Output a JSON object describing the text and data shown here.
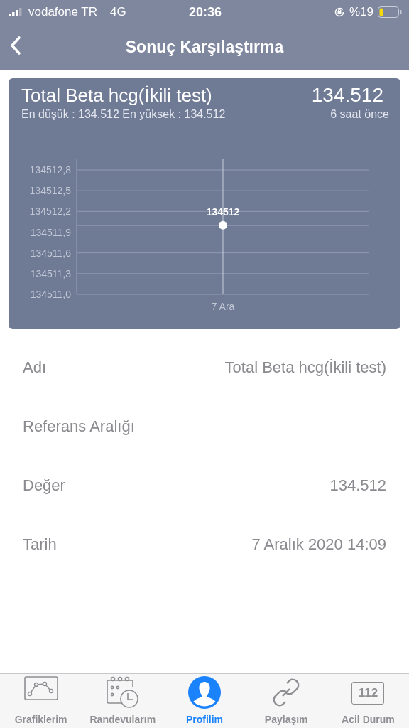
{
  "status_bar": {
    "carrier": "vodafone TR",
    "network": "4G",
    "time": "20:36",
    "battery": "%19"
  },
  "nav": {
    "title": "Sonuç Karşılaştırma"
  },
  "card": {
    "title": "Total Beta hcg(İkili test)",
    "value": "134.512",
    "range": "En düşük : 134.512 En yüksek : 134.512",
    "ago": "6 saat önce",
    "chart_data": {
      "type": "scatter",
      "categories": [
        "7 Ara"
      ],
      "series": [
        {
          "color": "#ffffff",
          "values": [
            134512
          ]
        }
      ],
      "grid": true,
      "ref_lines": [
        {
          "axis": "x",
          "value": "7 Ara"
        },
        {
          "axis": "y",
          "value": 134512
        }
      ],
      "ylim": [
        134511.0,
        134512.8
      ],
      "yticks": [
        {
          "value": 134511.0,
          "label": "134511,0"
        },
        {
          "value": 134511.3,
          "label": "134511,3"
        },
        {
          "value": 134511.6,
          "label": "134511,6"
        },
        {
          "value": 134511.9,
          "label": "134511,9"
        },
        {
          "value": 134512.2,
          "label": "134512,2"
        },
        {
          "value": 134512.5,
          "label": "134512,5"
        },
        {
          "value": 134512.8,
          "label": "134512,8"
        }
      ],
      "data_labels": true,
      "value_labels": [
        "134512"
      ]
    }
  },
  "details": [
    {
      "label": "Adı",
      "value": "Total Beta hcg(İkili test)"
    },
    {
      "label": "Referans Aralığı"
    },
    {
      "label": "Değer",
      "value": "134.512"
    },
    {
      "label": "Tarih",
      "value": "7 Aralık 2020 14:09"
    }
  ],
  "tabs": [
    {
      "kind": "chart",
      "label": "Grafiklerim",
      "selected": false
    },
    {
      "kind": "calendar",
      "label": "Randevularım",
      "selected": false
    },
    {
      "kind": "profile",
      "label": "Profilim",
      "selected": true
    },
    {
      "kind": "link",
      "label": "Paylaşım",
      "selected": false
    },
    {
      "kind": "emergency",
      "label": "Acil Durum",
      "icon_text": "112",
      "selected": false
    }
  ]
}
